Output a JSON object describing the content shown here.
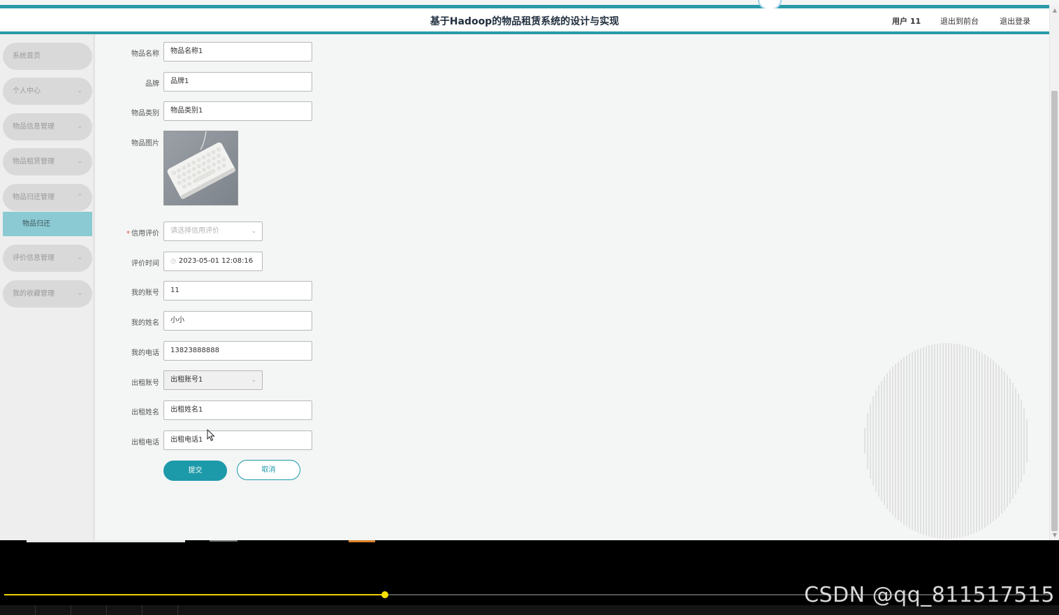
{
  "header": {
    "title": "基于Hadoop的物品租赁系统的设计与实现",
    "user": "用户 11",
    "to_front": "退出到前台",
    "logout": "退出登录"
  },
  "sidebar": {
    "items": [
      {
        "label": "系统首页"
      },
      {
        "label": "个人中心",
        "chevron": "⌄"
      },
      {
        "label": "物品信息管理",
        "chevron": "⌄"
      },
      {
        "label": "物品租赁管理",
        "chevron": "⌄"
      },
      {
        "label": "物品归还管理",
        "chevron": "⌃"
      },
      {
        "label": "评价信息管理",
        "chevron": "⌄"
      },
      {
        "label": "我的收藏管理",
        "chevron": "⌄"
      }
    ],
    "active_sub": "物品归还"
  },
  "form": {
    "fields": {
      "item_name": {
        "label": "物品名称",
        "value": "物品名称1"
      },
      "brand": {
        "label": "品牌",
        "value": "品牌1"
      },
      "category": {
        "label": "物品类别",
        "value": "物品类别1"
      },
      "image": {
        "label": "物品图片"
      },
      "credit": {
        "label": "信用评价",
        "required": "*",
        "placeholder": "请选择信用评价"
      },
      "eval_time": {
        "label": "评价时间",
        "value": "2023-05-01 12:08:16"
      },
      "my_account": {
        "label": "我的账号",
        "value": "11"
      },
      "my_name": {
        "label": "我的姓名",
        "value": "小小"
      },
      "my_phone": {
        "label": "我的电话",
        "value": "13823888888"
      },
      "rent_account": {
        "label": "出租账号",
        "value": "出租账号1"
      },
      "rent_name": {
        "label": "出租姓名",
        "value": "出租姓名1"
      },
      "rent_phone": {
        "label": "出租电话",
        "value": "出租电话1"
      }
    },
    "submit": "提交",
    "cancel": "取消"
  },
  "player": {
    "progress": 0.364,
    "watermark": "CSDN @qq_811517515"
  },
  "colors": {
    "accent": "#2a9aa8",
    "button": "#1d9aa9",
    "active_sub_bg": "#8ccad3",
    "progress": "#f0d000"
  }
}
